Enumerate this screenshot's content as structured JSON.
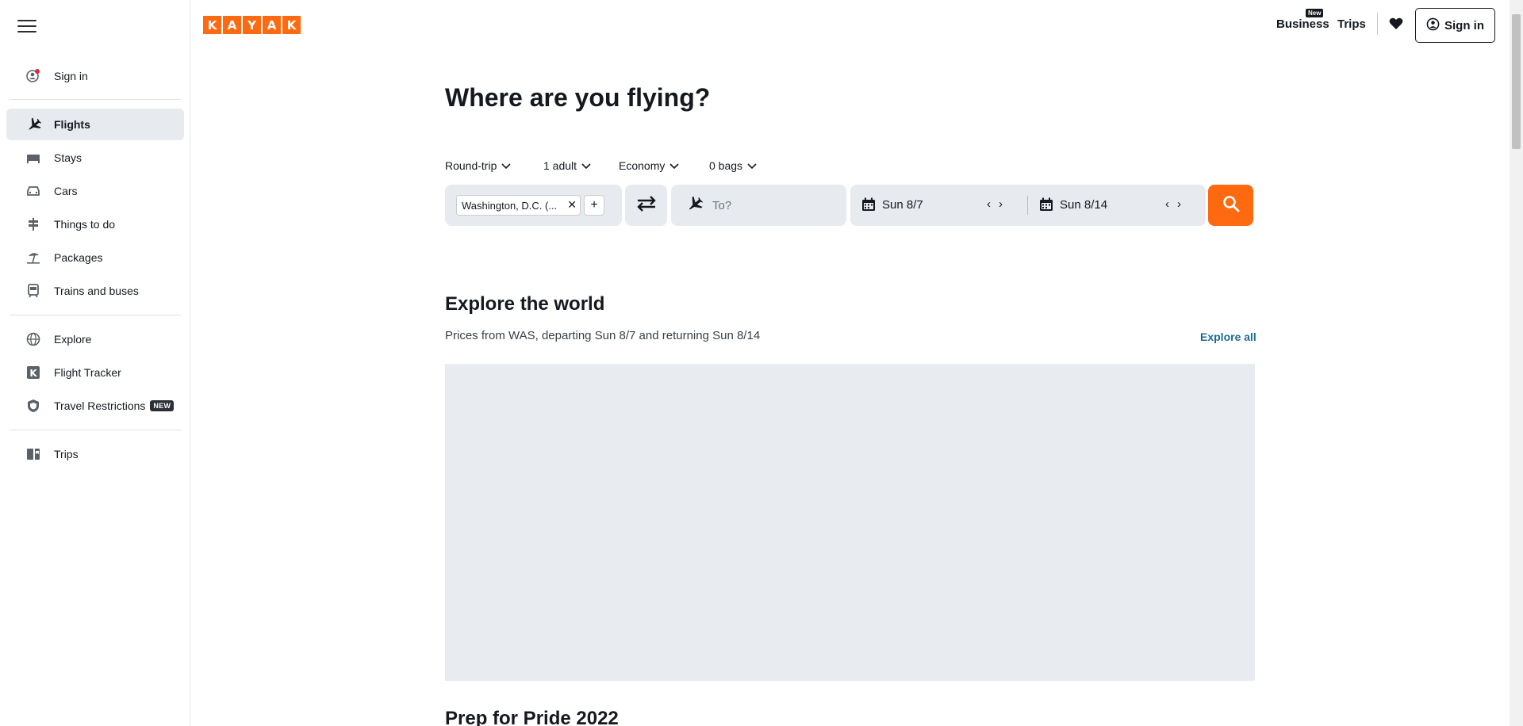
{
  "sidebar": {
    "items": [
      {
        "label": "Sign in",
        "icon": "user-icon"
      },
      {
        "label": "Flights",
        "icon": "plane-icon",
        "active": true
      },
      {
        "label": "Stays",
        "icon": "bed-icon"
      },
      {
        "label": "Cars",
        "icon": "car-icon"
      },
      {
        "label": "Things to do",
        "icon": "signpost-icon"
      },
      {
        "label": "Packages",
        "icon": "beach-icon"
      },
      {
        "label": "Trains and buses",
        "icon": "train-icon"
      },
      {
        "label": "Explore",
        "icon": "globe-icon"
      },
      {
        "label": "Flight Tracker",
        "icon": "k-icon"
      },
      {
        "label": "Travel Restrictions",
        "icon": "shield-icon",
        "badge": "NEW"
      },
      {
        "label": "Trips",
        "icon": "trips-icon"
      }
    ]
  },
  "header": {
    "logo_letters": [
      "K",
      "A",
      "Y",
      "A",
      "K"
    ],
    "business": "Business",
    "business_badge": "New",
    "trips": "Trips",
    "signin": "Sign in"
  },
  "search": {
    "title": "Where are you flying?",
    "trip_type": "Round-trip",
    "travelers": "1 adult",
    "cabin": "Economy",
    "bags": "0 bags",
    "origin": "Washington, D.C. (...",
    "destination_placeholder": "To?",
    "depart_date": "Sun 8/7",
    "return_date": "Sun 8/14"
  },
  "explore": {
    "title": "Explore the world",
    "subtitle": "Prices from WAS, departing Sun 8/7 and returning Sun 8/14",
    "explore_all": "Explore all"
  },
  "next_section": {
    "title": "Prep for Pride 2022"
  },
  "colors": {
    "brand": "#ff690f",
    "link": "#1b6a96",
    "field_bg": "#e7eaee"
  }
}
